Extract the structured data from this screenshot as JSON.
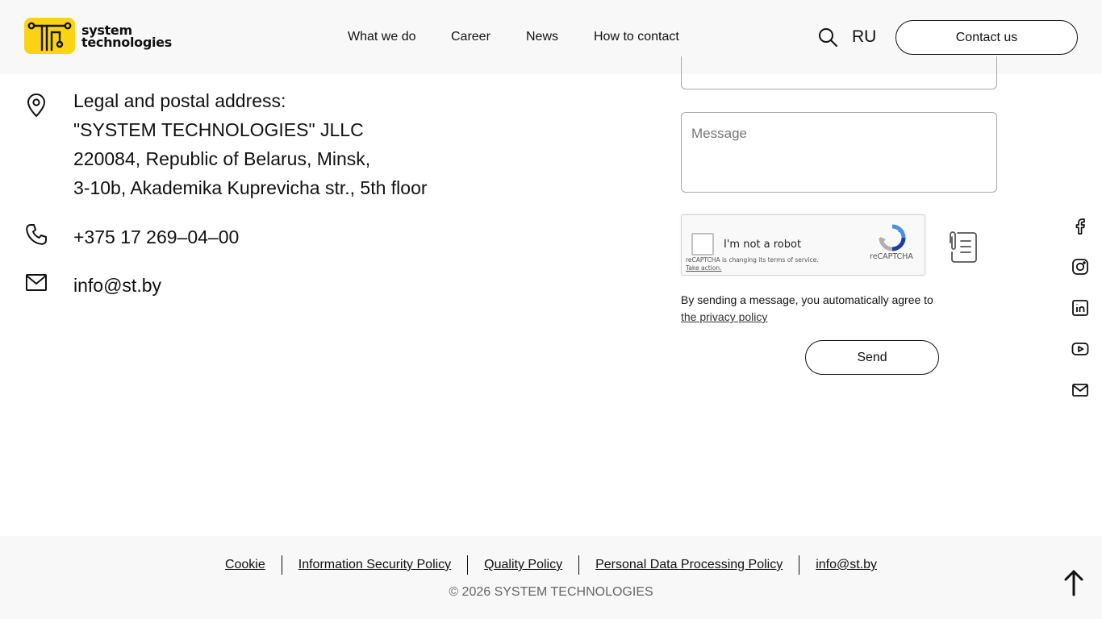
{
  "header": {
    "logo_line1": "system",
    "logo_line2": "technologies",
    "nav": [
      "What we do",
      "Career",
      "News",
      "How to contact"
    ],
    "lang": "RU",
    "contact_label": "Contact us"
  },
  "contacts": {
    "address_lines": [
      "Legal and postal address:",
      "\"SYSTEM TECHNOLOGIES\" JLLC",
      "220084, Republic of Belarus, Minsk,",
      "3-10b, Akademika Kuprevicha str., 5th floor"
    ],
    "phone": "+375 17 269–04–00",
    "email": "info@st.by"
  },
  "form": {
    "message_placeholder": "Message",
    "recaptcha_label": "I'm not a robot",
    "recaptcha_brand": "reCAPTCHA",
    "recaptcha_notice": "reCAPTCHA is changing its terms of service.",
    "recaptcha_action": "Take action.",
    "agree_text": "By sending a message, you automatically agree to",
    "privacy_link": "the privacy policy",
    "send_label": "Send"
  },
  "social": [
    "facebook-icon",
    "instagram-icon",
    "linkedin-icon",
    "youtube-icon",
    "mail-icon"
  ],
  "footer": {
    "links": [
      "Cookie",
      "Information Security Policy",
      "Quality Policy",
      "Personal Data Processing Policy",
      "info@st.by"
    ],
    "copyright": "© 2026 SYSTEM TECHNOLOGIES"
  },
  "colors": {
    "brand_yellow": "#f9d314",
    "background": "#f8f8f8",
    "text": "#111111"
  }
}
